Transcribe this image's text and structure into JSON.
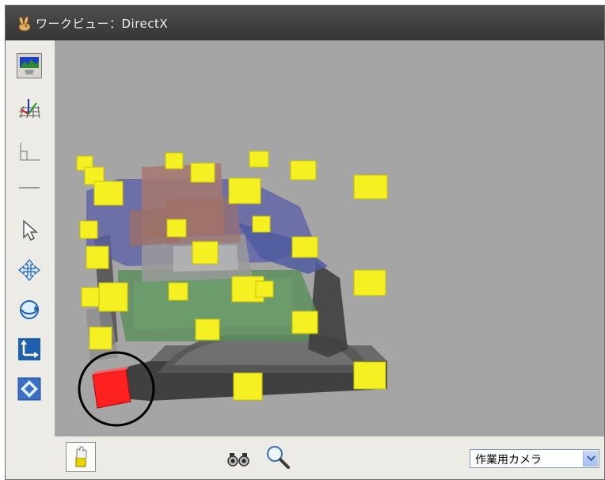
{
  "window": {
    "title": "ワークビュー：DirectX",
    "title_icon": "rabbit-app-icon"
  },
  "left_toolbar": {
    "items": [
      {
        "name": "view-display-icon",
        "active": true
      },
      {
        "name": "grid-axes-icon",
        "active": false
      },
      {
        "name": "coordinate-frame-icon",
        "active": false
      },
      {
        "name": "line-icon",
        "active": false
      },
      {
        "name": "pointer-arrow-icon",
        "active": false
      },
      {
        "name": "pan-move-icon",
        "active": false
      },
      {
        "name": "rotate-view-icon",
        "active": false
      },
      {
        "name": "axis-transform-icon",
        "active": false
      },
      {
        "name": "fit-view-icon",
        "active": false
      }
    ]
  },
  "viewport": {
    "background_color": "#a5a5a5",
    "marker_color": "#f5f021",
    "selected_marker_color": "#ff2020",
    "highlight_circle_color": "#000000"
  },
  "bottom_bar": {
    "tool_button_icon": "hand-tool-icon",
    "binoculars_icon": "binoculars-icon",
    "zoom_icon": "magnifier-icon",
    "camera_select": {
      "value": "作業用カメラ"
    }
  }
}
